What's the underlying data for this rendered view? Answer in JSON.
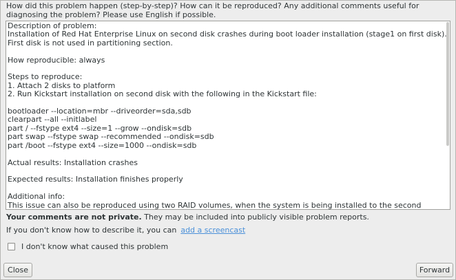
{
  "prompt": {
    "text": "How did this problem happen (step-by-step)? How can it be reproduced? Any additional comments useful for diagnosing the problem? Please use English if possible."
  },
  "description": {
    "lines": [
      "Description of problem:",
      "Installation of Red Hat Enterprise Linux on second disk crashes during boot loader installation (stage1 on first disk). First disk is not used in partitioning section.",
      "",
      "How reproducible: always",
      "",
      "Steps to reproduce:",
      "1. Attach 2 disks to platform",
      "2. Run Kickstart installation on second disk with the following in the Kickstart file:",
      "",
      "bootloader --location=mbr --driveorder=sda,sdb",
      "clearpart --all --initlabel",
      "part / --fstype ext4 --size=1 --grow --ondisk=sdb",
      "part swap --fstype swap --recommended --ondisk=sdb",
      "part /boot --fstype ext4 --size=1000 --ondisk=sdb",
      "",
      "Actual results: Installation crashes",
      "",
      "Expected results: Installation finishes properly",
      "",
      "Additional info:",
      "This issue can also be reproduced using two RAID volumes, when the system is being installed to the second volume."
    ]
  },
  "privacy": {
    "bold": "Your comments are not private.",
    "rest": " They may be included into publicly visible problem reports."
  },
  "describe": {
    "text": "If you don't know how to describe it, you can",
    "link": "add a screencast"
  },
  "checkbox": {
    "label": "I don't know what caused this problem",
    "checked": false
  },
  "buttons": {
    "close": "Close",
    "forward": "Forward"
  }
}
